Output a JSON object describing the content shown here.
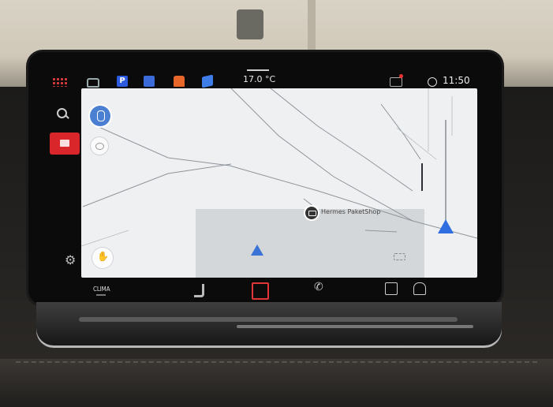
{
  "status_bar": {
    "temperature": "17.0 °C",
    "time": "11:50",
    "parking_label": "P"
  },
  "map": {
    "poi_label": "Hermes PaketShop"
  },
  "bottom_bar": {
    "clima_label": "CLIMA"
  },
  "colors": {
    "accent_red": "#d8262b",
    "map_blue": "#3a72d6",
    "map_bg": "#eef0f2"
  },
  "icons": {
    "status": [
      "apps-grid-icon",
      "car-icon",
      "parking-icon",
      "building-icon",
      "food-icon",
      "tag-icon",
      "mail-icon",
      "globe-icon"
    ],
    "rail": [
      "search-icon",
      "navigation-icon",
      "settings-icon"
    ],
    "bottom": [
      "seat-icon",
      "home-icon",
      "phone-icon",
      "front-defrost-icon",
      "rear-defrost-icon"
    ]
  }
}
